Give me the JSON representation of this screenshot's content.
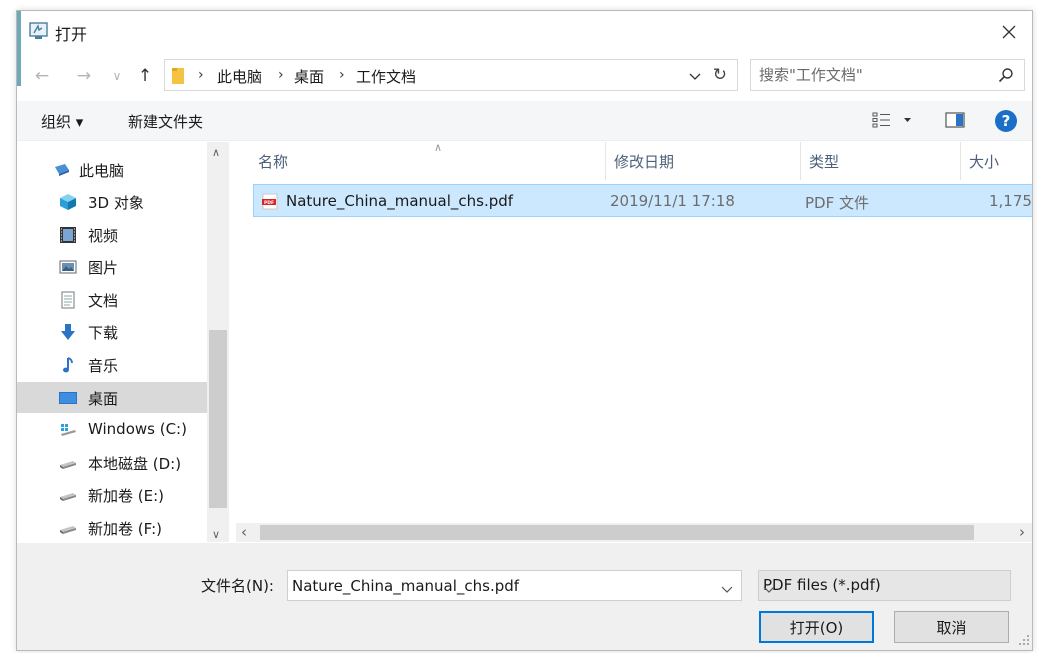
{
  "window": {
    "title": "打开"
  },
  "address": {
    "breadcrumbs": [
      "此电脑",
      "桌面",
      "工作文档"
    ]
  },
  "search": {
    "placeholder": "搜索\"工作文档\""
  },
  "toolbar": {
    "organize_label": "组织 ▾",
    "new_folder_label": "新建文件夹"
  },
  "nav": {
    "items": [
      {
        "label": "此电脑",
        "icon": "computer-icon"
      },
      {
        "label": "3D 对象",
        "icon": "3d-objects-icon"
      },
      {
        "label": "视频",
        "icon": "video-icon"
      },
      {
        "label": "图片",
        "icon": "pictures-icon"
      },
      {
        "label": "文档",
        "icon": "documents-icon"
      },
      {
        "label": "下载",
        "icon": "download-icon"
      },
      {
        "label": "音乐",
        "icon": "music-icon"
      },
      {
        "label": "桌面",
        "icon": "desktop-icon"
      },
      {
        "label": "Windows (C:)",
        "icon": "drive-icon"
      },
      {
        "label": "本地磁盘 (D:)",
        "icon": "drive-icon"
      },
      {
        "label": "新加卷 (E:)",
        "icon": "drive-icon"
      },
      {
        "label": "新加卷 (F:)",
        "icon": "drive-icon"
      }
    ],
    "selected": "桌面"
  },
  "file_list": {
    "columns": [
      "名称",
      "修改日期",
      "类型",
      "大小"
    ],
    "rows": [
      {
        "name": "Nature_China_manual_chs.pdf",
        "modified": "2019/11/1 17:18",
        "type": "PDF 文件",
        "size": "1,175",
        "icon": "pdf-icon"
      }
    ]
  },
  "filename": {
    "label": "文件名(N):",
    "value": "Nature_China_manual_chs.pdf"
  },
  "filetype": {
    "selected": "PDF files (*.pdf)"
  },
  "buttons": {
    "open": "打开(O)",
    "cancel": "取消"
  },
  "colors": {
    "selection_bg": "#cce8ff",
    "selection_border": "#99d1ff",
    "accent": "#0078d7",
    "nav_selected": "#d9d9d9",
    "header_text": "#4c607a"
  }
}
